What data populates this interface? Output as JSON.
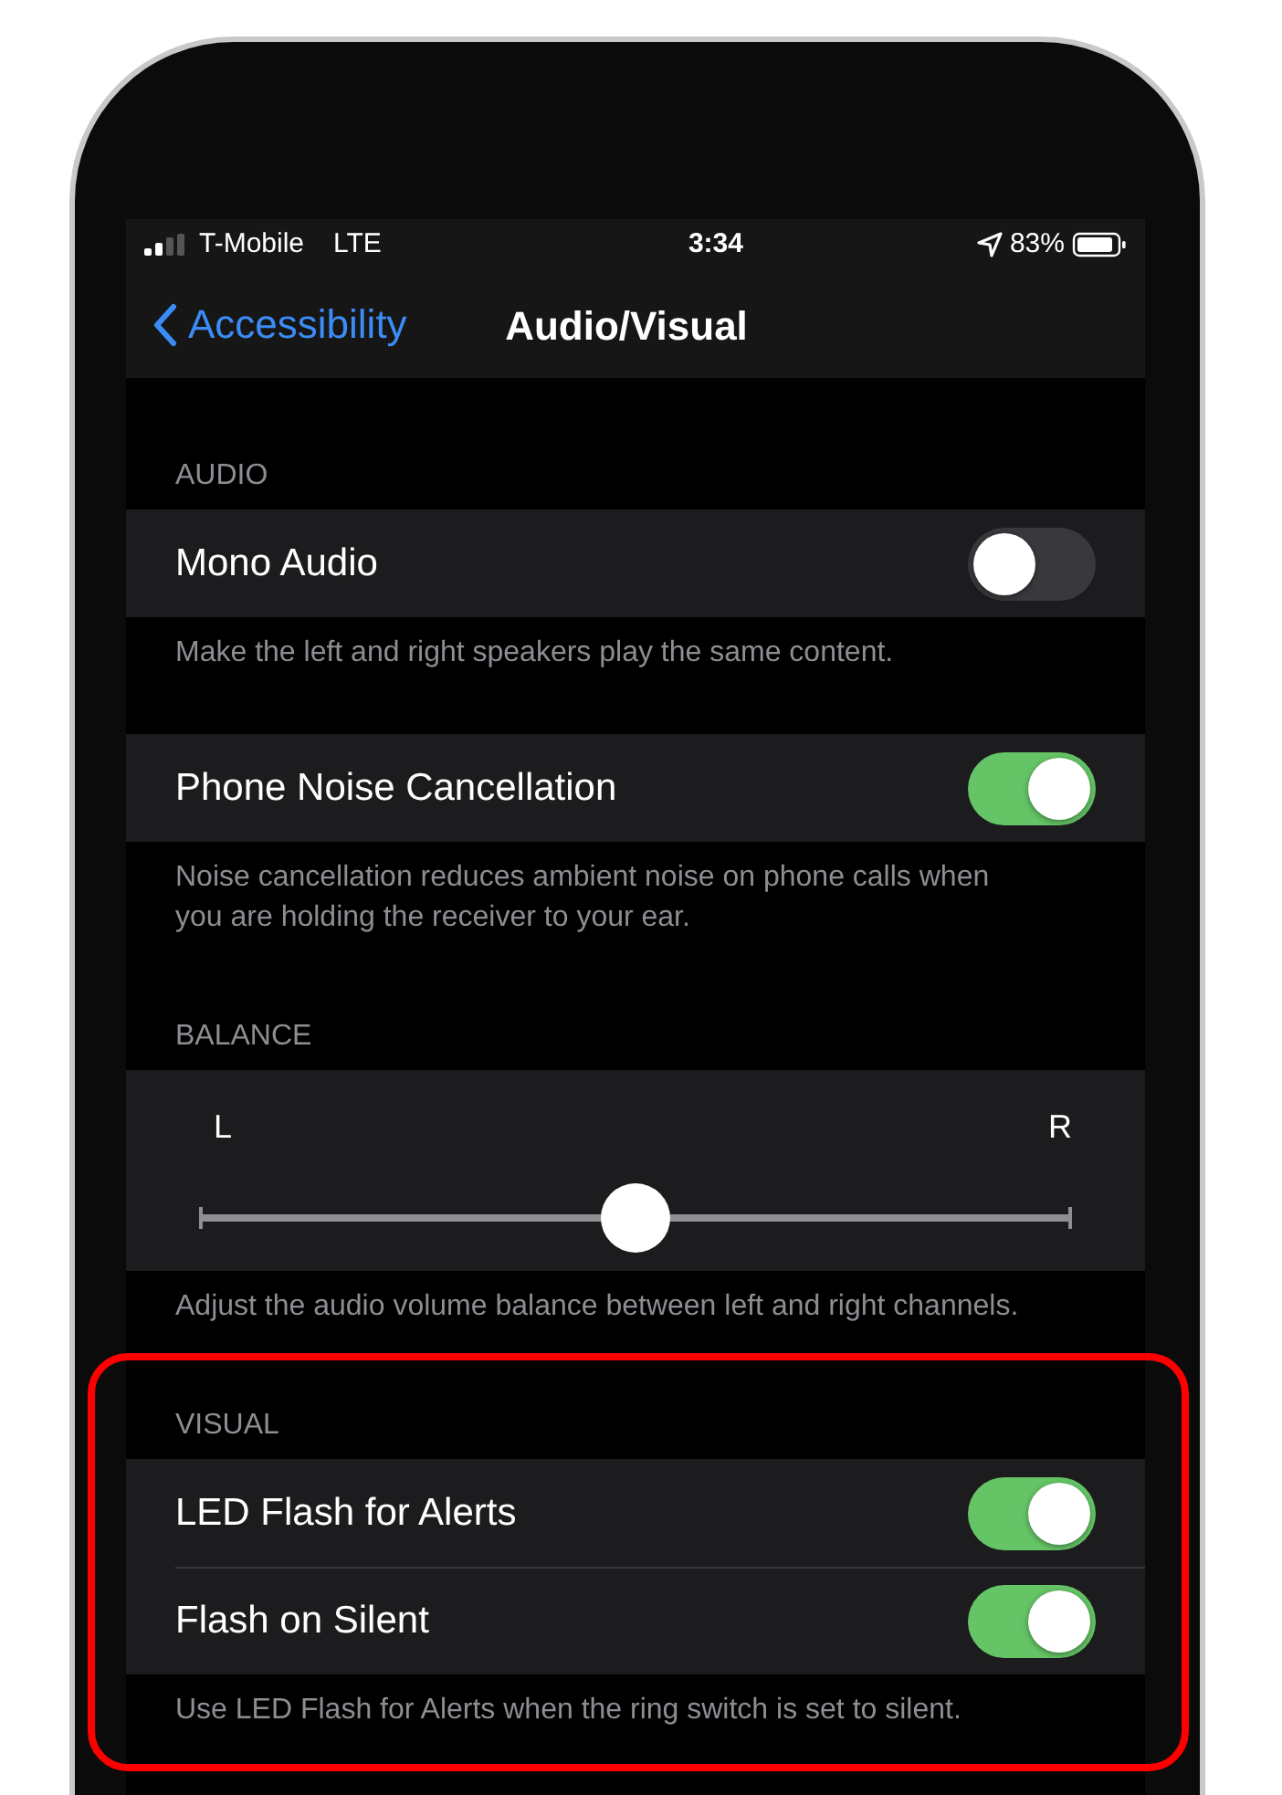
{
  "status_bar": {
    "carrier": "T-Mobile",
    "network": "LTE",
    "time": "3:34",
    "battery": "83%"
  },
  "nav": {
    "back": "Accessibility",
    "title": "Audio/Visual"
  },
  "sections": [
    {
      "header": "AUDIO",
      "highlighted": false,
      "rows": [
        {
          "kind": "toggle",
          "label": "Mono Audio",
          "on": false
        }
      ],
      "footer": "Make the left and right speakers play the same content."
    },
    {
      "highlighted": false,
      "rows": [
        {
          "kind": "toggle",
          "label": "Phone Noise Cancellation",
          "on": true
        }
      ],
      "footer": "Noise cancellation reduces ambient noise on phone calls when you are holding the receiver to your ear."
    },
    {
      "header": "BALANCE",
      "highlighted": false,
      "rows": [
        {
          "kind": "slider",
          "left_label": "L",
          "right_label": "R",
          "level": 0.5
        }
      ],
      "footer": "Adjust the audio volume balance between left and right channels."
    },
    {
      "header": "VISUAL",
      "highlighted": true,
      "rows": [
        {
          "kind": "toggle",
          "label": "LED Flash for Alerts",
          "on": true
        },
        {
          "kind": "toggle",
          "label": "Flash on Silent",
          "on": true
        }
      ],
      "footer": "Use LED Flash for Alerts when the ring switch is set to silent."
    }
  ]
}
